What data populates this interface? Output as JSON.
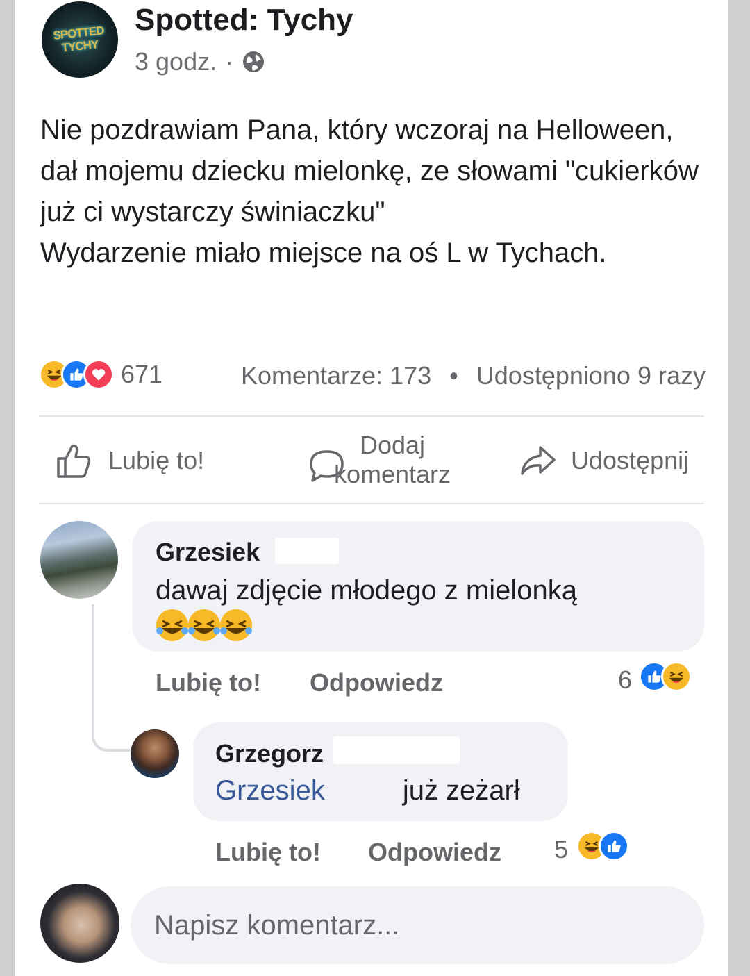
{
  "post": {
    "page_name": "Spotted: Tychy",
    "page_logo_text": "SPOTTED TYCHY",
    "time": "3 godz.",
    "separator": "·",
    "text": "Nie pozdrawiam Pana, który wczoraj na Helloween, dał mojemu dziecku mielonkę, ze słowami \"cukierków już ci wystarczy świniaczku\"\nWydarzenie miało miejsce na oś L w Tychach.",
    "reaction_icons": [
      "haha",
      "like",
      "love"
    ],
    "reaction_count": "671",
    "comments_label": "Komentarze: 173",
    "stats_dot": "•",
    "shares_label": "Udostępniono 9 razy"
  },
  "actions": {
    "like": "Lubię to!",
    "comment": "Dodaj komentarz",
    "share": "Udostępnij"
  },
  "comments": [
    {
      "author": "Grzesiek",
      "text": "dawaj zdjęcie młodego z mielonką",
      "emojis": [
        "rolling-laughing",
        "rolling-laughing",
        "rolling-laughing"
      ],
      "like_label": "Lubię to!",
      "reply_label": "Odpowiedz",
      "reaction_count": "6",
      "reaction_icons": [
        "like",
        "haha"
      ]
    },
    {
      "author": "Grzegorz",
      "mention": "Grzesiek",
      "text": "już zeżarł",
      "like_label": "Lubię to!",
      "reply_label": "Odpowiedz",
      "reaction_count": "5",
      "reaction_icons": [
        "haha",
        "like"
      ]
    }
  ],
  "composer": {
    "placeholder": "Napisz komentarz..."
  },
  "colors": {
    "like_blue": "#1877f2",
    "love_red": "#f33e58",
    "haha_yellow": "#f7b928",
    "mention_blue": "#385898",
    "secondary_text": "#65676b"
  }
}
